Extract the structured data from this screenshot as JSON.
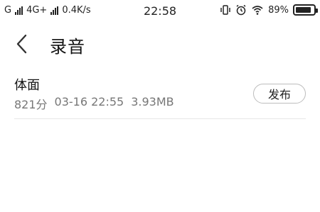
{
  "status_bar": {
    "carrier1": "G",
    "carrier2": "4G+",
    "speed": "0.4K/s",
    "time": "22:58",
    "battery_text": "89%",
    "battery_level": 0.89
  },
  "header": {
    "title": "录音"
  },
  "recording": {
    "title": "体面",
    "duration": "821分",
    "datetime": "03-16 22:55",
    "size": "3.93MB",
    "publish_label": "发布"
  }
}
